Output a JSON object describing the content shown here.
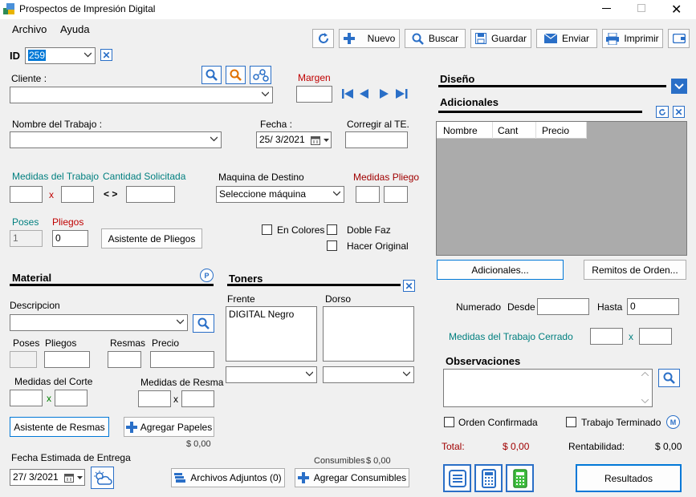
{
  "window": {
    "title": "Prospectos de Impresión Digital"
  },
  "menu": {
    "archivo": "Archivo",
    "ayuda": "Ayuda"
  },
  "toolbar": {
    "nuevo": "Nuevo",
    "buscar": "Buscar",
    "guardar": "Guardar",
    "enviar": "Enviar",
    "imprimir": "Imprimir"
  },
  "header": {
    "id_label": "ID",
    "id_value": "259"
  },
  "cliente": {
    "label": "Cliente :",
    "value": ""
  },
  "margen": {
    "label": "Margen",
    "value": ""
  },
  "trabajo": {
    "label": "Nombre del Trabajo :",
    "value": ""
  },
  "fecha": {
    "label": "Fecha :",
    "value": "25/  3/2021"
  },
  "corregir": {
    "label": "Corregir al TE.",
    "value": ""
  },
  "medidas_trabajo": {
    "label": "Medidas del Trabajo",
    "x": "x"
  },
  "cantidad": {
    "label": "Cantidad Solicitada",
    "nav": "< >"
  },
  "maquina": {
    "label": "Maquina de Destino",
    "value": "Seleccione máquina"
  },
  "medidas_pliego": {
    "label": "Medidas Pliego"
  },
  "poses": {
    "label": "Poses",
    "value": "1"
  },
  "pliegos": {
    "label": "Pliegos",
    "value": "0"
  },
  "asistente_pliegos": "Asistente de Pliegos",
  "checks": {
    "en_colores": "En Colores",
    "doble_faz": "Doble Faz",
    "hacer_original": "Hacer Original"
  },
  "material": {
    "title": "Material",
    "descripcion": "Descripcion",
    "poses": "Poses",
    "pliegos": "Pliegos",
    "resmas": "Resmas",
    "precio": "Precio",
    "medidas_corte": "Medidas del Corte",
    "medidas_resma": "Medidas de Resma",
    "x": "x",
    "asistente_resmas": "Asistente de Resmas",
    "agregar_papeles": "Agregar Papeles",
    "total": "$ 0,00"
  },
  "toners": {
    "title": "Toners",
    "frente": "Frente",
    "dorso": "Dorso",
    "frente_items": [
      "DIGITAL Negro"
    ]
  },
  "entrega": {
    "label": "Fecha Estimada de Entrega",
    "value": "27/  3/2021"
  },
  "archivos": "Archivos Adjuntos (0)",
  "consumibles": {
    "label": "Consumibles",
    "value": "$ 0,00",
    "button": "Agregar Consumibles"
  },
  "diseno": {
    "title": "Diseño"
  },
  "adicionales": {
    "title": "Adicionales",
    "columns": [
      "Nombre",
      "Cant",
      "Precio"
    ],
    "button": "Adicionales...",
    "remitos": "Remitos de Orden..."
  },
  "numerado": {
    "label": "Numerado",
    "desde": "Desde",
    "hasta": "Hasta",
    "desde_value": "",
    "hasta_value": "0"
  },
  "cerrado": {
    "label": "Medidas del Trabajo Cerrado",
    "x": "x"
  },
  "observaciones": {
    "label": "Observaciones",
    "value": ""
  },
  "status": {
    "orden_confirmada": "Orden Confirmada",
    "trabajo_terminado": "Trabajo Terminado"
  },
  "totals": {
    "total_label": "Total:",
    "total_value": "$ 0,00",
    "rent_label": "Rentabilidad:",
    "rent_value": "$ 0,00"
  },
  "resultados": "Resultados"
}
